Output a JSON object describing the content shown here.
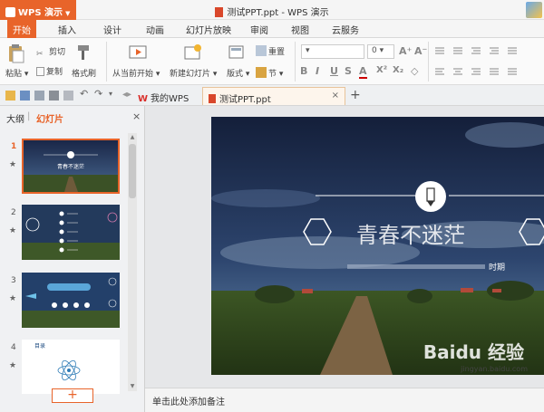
{
  "app": {
    "name": "WPS 演示",
    "window_title": "测试PPT.ppt - WPS 演示"
  },
  "menu_tabs": [
    "开始",
    "插入",
    "设计",
    "动画",
    "幻灯片放映",
    "审阅",
    "视图",
    "云服务"
  ],
  "ribbon": {
    "paste": "粘贴",
    "cut": "剪切",
    "copy": "复制",
    "format_painter": "格式刷",
    "from_current": "从当前开始",
    "new_slide": "新建幻灯片",
    "layout": "版式",
    "section": "节",
    "reset": "重置",
    "font_size": "0",
    "bold": "B",
    "italic": "I",
    "underline": "U",
    "strike": "S",
    "font_color": "A",
    "superscript": "X²",
    "subscript": "X₂"
  },
  "doc_tabs": {
    "home": "我的WPS",
    "file": "测试PPT.ppt",
    "close": "×",
    "add": "+"
  },
  "left_panel": {
    "outline": "大纲",
    "slides": "幻灯片",
    "close": "×",
    "thumbs": [
      {
        "num": "1",
        "star": "★",
        "title": "青春不迷茫"
      },
      {
        "num": "2",
        "star": "★",
        "title": ""
      },
      {
        "num": "3",
        "star": "★",
        "title": ""
      },
      {
        "num": "4",
        "star": "★",
        "title": "目录"
      }
    ],
    "add_button": "+"
  },
  "slide": {
    "title": "青春不迷茫",
    "subtitle": "时期"
  },
  "notes_placeholder": "单击此处添加备注",
  "watermark": {
    "brand": "Baidu 经验",
    "url": "jingyan.baidu.com"
  },
  "colors": {
    "accent": "#e8642a",
    "sky": "#1b2a4a",
    "grass": "#3d5a2a"
  }
}
